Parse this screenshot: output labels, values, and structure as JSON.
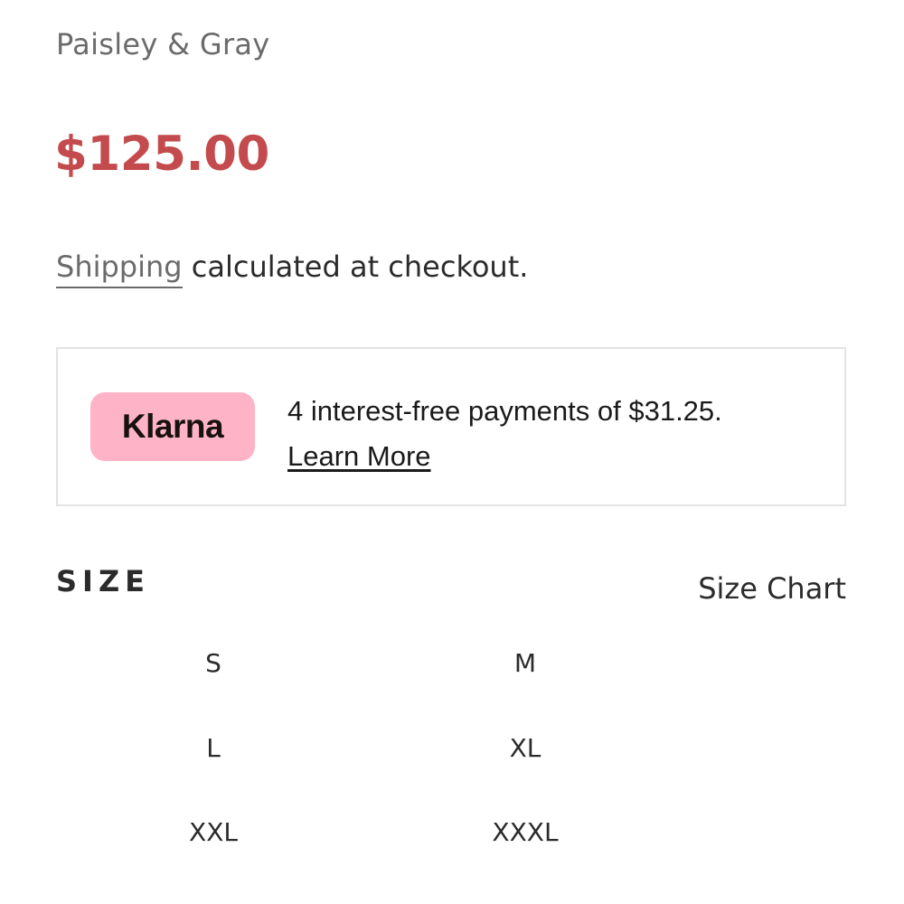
{
  "product": {
    "vendor": "Paisley & Gray",
    "price": "$125.00",
    "shipping_link": "Shipping",
    "shipping_rest": " calculated at checkout."
  },
  "klarna": {
    "logo_text": "Klarna",
    "message": "4 interest-free payments of $31.25.",
    "learn_more": "Learn More",
    "badge_color": "#ffb3c7"
  },
  "size_selector": {
    "label": "SIZE",
    "size_chart_label": "Size Chart",
    "options": [
      "S",
      "M",
      "L",
      "XL",
      "XXL",
      "XXXL"
    ]
  },
  "colors": {
    "price": "#c44b4d",
    "text": "#2b2b2b",
    "muted": "#6b6b6b",
    "border": "#e3e3e3"
  }
}
